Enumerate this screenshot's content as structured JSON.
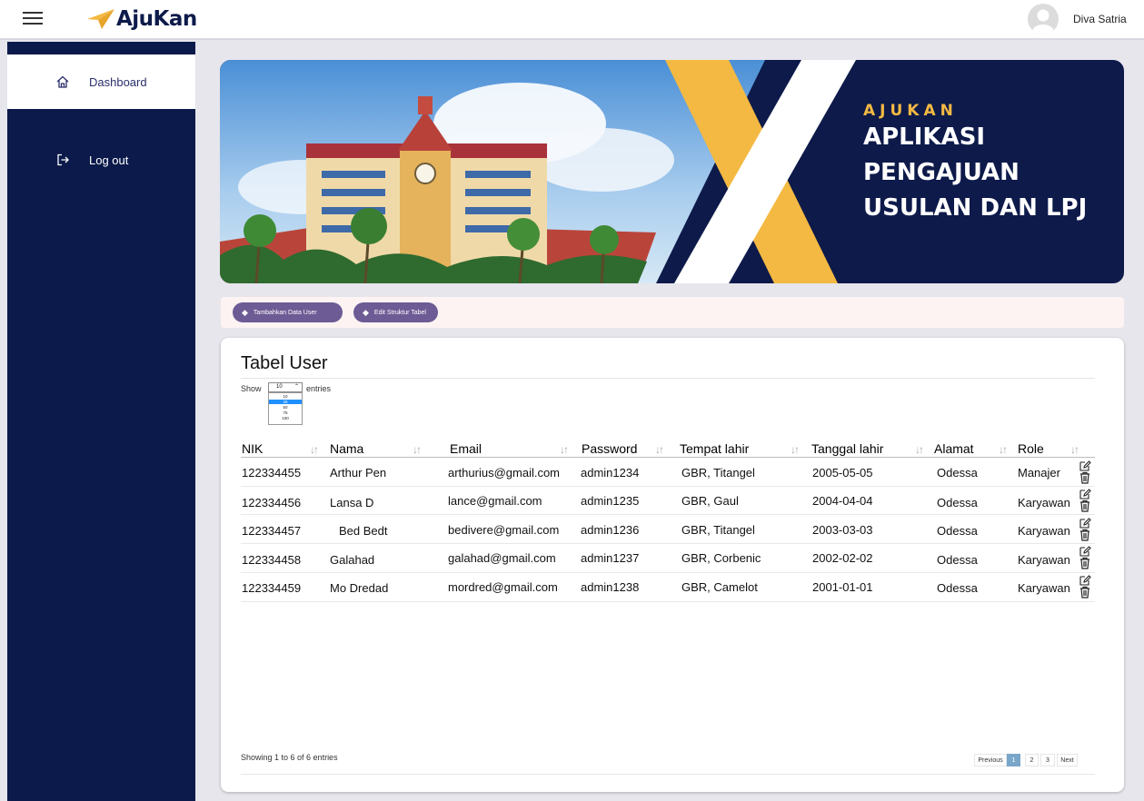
{
  "header": {
    "app_name": "AjuKan",
    "user_name": "Diva Satria"
  },
  "sidebar": {
    "items": [
      {
        "label": "Dashboard",
        "icon": "home-icon"
      },
      {
        "label": "Log out",
        "icon": "logout-icon"
      }
    ]
  },
  "banner": {
    "subtitle": "AJUKAN",
    "title_lines": [
      "APLIKASI",
      "PENGAJUAN",
      "USULAN DAN LPJ"
    ]
  },
  "actions": {
    "add_user": "Tambahkan Data User",
    "edit_structure": "Edit Struktur Tabel"
  },
  "table": {
    "title": "Tabel User",
    "show_label": "Show",
    "entries_label": "entries",
    "page_length": "10",
    "page_length_options": [
      "10",
      "25",
      "50",
      "75",
      "100"
    ],
    "columns": [
      "NIK",
      "Nama",
      "Email",
      "Password",
      "Tempat lahir",
      "Tanggal lahir",
      "Alamat",
      "Role"
    ],
    "rows": [
      [
        "122334455",
        "Arthur Pen",
        "arthurius@gmail.com",
        "admin1234",
        "GBR, Titangel",
        "2005-05-05",
        "Odessa",
        "Manajer"
      ],
      [
        "122334456",
        "Lansa D",
        "lance@gmail.com",
        "admin1235",
        "GBR, Gaul",
        "2004-04-04",
        "Odessa",
        "Karyawan"
      ],
      [
        "122334457",
        "Bed Bedt",
        "bedivere@gmail.com",
        "admin1236",
        "GBR, Titangel",
        "2003-03-03",
        "Odessa",
        "Karyawan"
      ],
      [
        "122334458",
        "Galahad",
        "galahad@gmail.com",
        "admin1237",
        "GBR, Corbenic",
        "2002-02-02",
        "Odessa",
        "Karyawan"
      ],
      [
        "122334459",
        "Mo Dredad",
        "mordred@gmail.com",
        "admin1238",
        "GBR, Camelot",
        "2001-01-01",
        "Odessa",
        "Karyawan"
      ]
    ],
    "info": "Showing 1 to 6 of 6 entries",
    "pagination": {
      "previous": "Previous",
      "pages": [
        "1",
        "2",
        "3"
      ],
      "next": "Next",
      "current": "1"
    }
  },
  "colors": {
    "sidebar": "#0b1a4a",
    "accent": "#6d5b95",
    "banner_yellow": "#f4b942",
    "page_active": "#7aa6c9"
  }
}
